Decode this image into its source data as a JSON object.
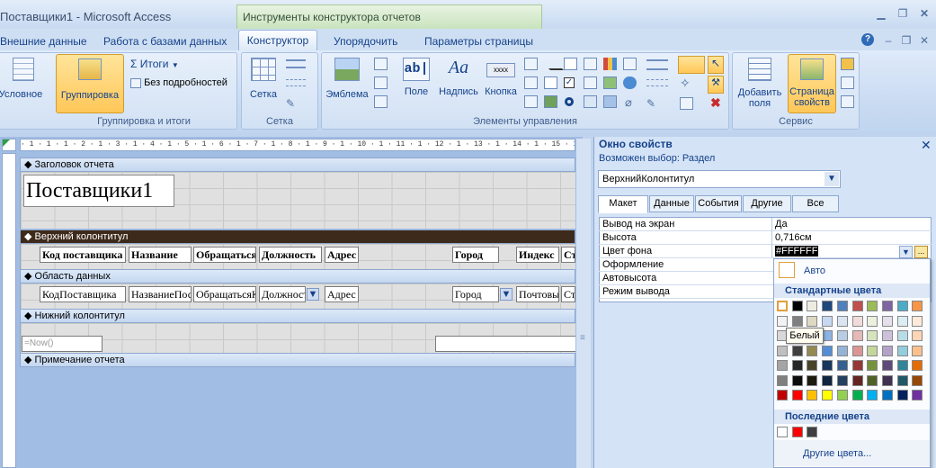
{
  "window": {
    "title": "Поставщики1 - Microsoft Access",
    "context_title": "Инструменты конструктора отчетов"
  },
  "tabs": [
    "Внешние данные",
    "Работа с базами данных",
    "Конструктор",
    "Упорядочить",
    "Параметры страницы"
  ],
  "ribbon": {
    "conditional_label": "Условное",
    "grouping_label": "Группировка",
    "totals_label": "Итоги",
    "hide_details_label": "Без подробностей",
    "group1_label": "Группировка и итоги",
    "grid_label": "Сетка",
    "group2_label": "Сетка",
    "logo_label": "Эмблема",
    "field_label": "Поле",
    "label_label": "Надпись",
    "button_label": "Кнопка",
    "textbox_glyph": "ab|",
    "label_glyph": "Aa",
    "button_glyph": "xxxx",
    "group3_label": "Элементы управления",
    "add_fields_label": "Добавить поля",
    "property_sheet_label": "Страница свойств",
    "group4_label": "Сервис"
  },
  "designer": {
    "ruler": "· 1 · 1 · 1 · 2 · 1 · 3 · 1 · 4 · 1 · 5 · 1 · 6 · 1 · 7 · 1 · 8 · 1 · 9 · 1 · 10 · 1 · 11 · 1 · 12 · 1 · 13 · 1 · 14 · 1 · 15 · 1 · 16 ·",
    "sections": {
      "report_header": "Заголовок отчета",
      "page_header": "Верхний колонтитул",
      "detail": "Область данных",
      "page_footer": "Нижний колонтитул",
      "report_footer": "Примечание отчета"
    },
    "report_title": "Поставщики1",
    "header_labels": [
      "Код поставщика",
      "Название",
      "Обращаться",
      "Должность",
      "Адрес",
      "Город",
      "Индекс",
      "Страна"
    ],
    "detail_fields": [
      "КодПоставщика",
      "НазваниеПоставщика",
      "ОбращатьсяК",
      "Должность",
      "Адрес",
      "Город",
      "ПочтовыйИндекс",
      "Страна"
    ],
    "footer_expr": "=Now()"
  },
  "property_sheet": {
    "title": "Окно свойств",
    "selection_info": "Возможен выбор: Раздел",
    "selected": "ВерхнийКолонтитул",
    "tabs": [
      "Макет",
      "Данные",
      "События",
      "Другие",
      "Все"
    ],
    "props": [
      {
        "name": "Вывод на экран",
        "value": "Да"
      },
      {
        "name": "Высота",
        "value": "0,716см"
      },
      {
        "name": "Цвет фона",
        "value": "#FFFFFF"
      },
      {
        "name": "Оформление",
        "value": ""
      },
      {
        "name": "Автовысота",
        "value": ""
      },
      {
        "name": "Режим вывода",
        "value": ""
      }
    ]
  },
  "palette": {
    "auto_label": "Авто",
    "standard_label": "Стандартные цвета",
    "recent_label": "Последние цвета",
    "more_label": "Другие цвета...",
    "tooltip": "Белый",
    "accent": "#e29f3b"
  }
}
